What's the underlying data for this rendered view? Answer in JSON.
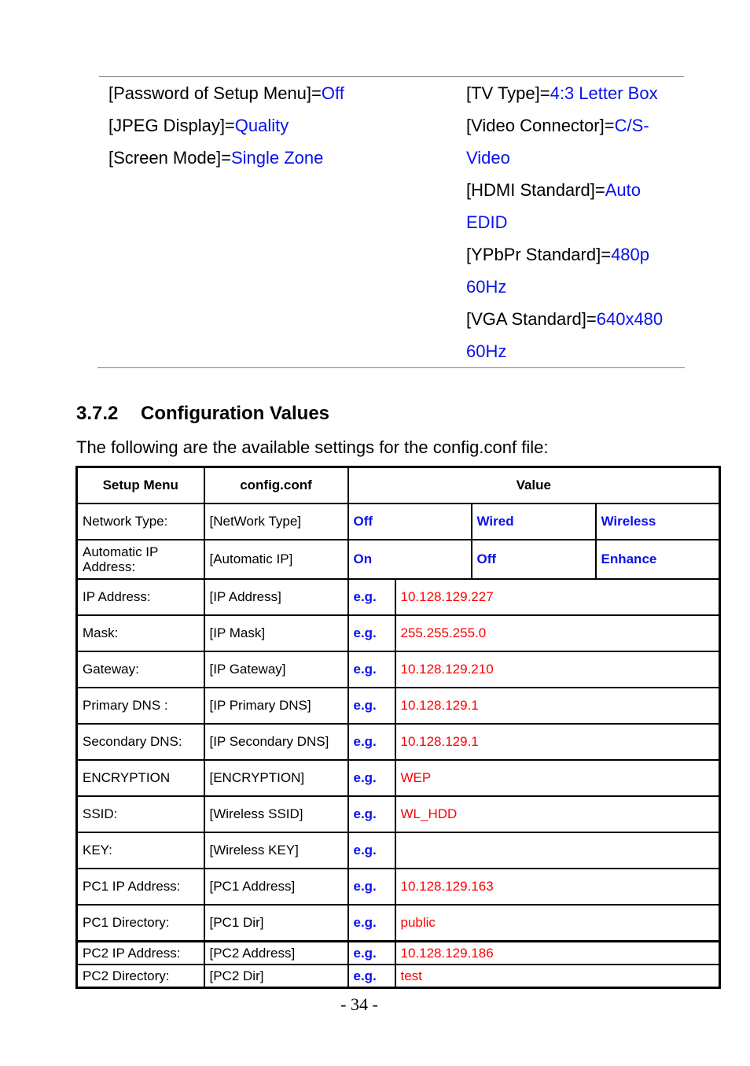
{
  "settings_left": [
    {
      "key": "[Password of Setup Menu]=",
      "value": "Off"
    },
    {
      "key": "[JPEG Display]=",
      "value": "Quality"
    },
    {
      "key": "[Screen Mode]=",
      "value": "Single Zone"
    }
  ],
  "settings_right": [
    {
      "key": "[TV Type]=",
      "value": "4:3 Letter Box"
    },
    {
      "key": "[Video Connector]=",
      "value": "C/S-Video"
    },
    {
      "key": "[HDMI Standard]=",
      "value": "Auto EDID"
    },
    {
      "key": "[YPbPr Standard]=",
      "value": "480p 60Hz"
    },
    {
      "key": "[VGA Standard]=",
      "value": "640x480 60Hz"
    }
  ],
  "section": {
    "number": "3.7.2",
    "title": "Configuration Values",
    "intro": "The following are the available settings for the config.conf file:"
  },
  "table": {
    "headers": [
      "Setup Menu",
      "config.conf",
      "Value"
    ],
    "option_rows": [
      {
        "menu": "Network Type:",
        "conf": "[NetWork Type]",
        "options": [
          "Off",
          "Wired",
          "Wireless"
        ]
      },
      {
        "menu": "Automatic IP Address:",
        "conf": "[Automatic IP]",
        "options": [
          "On",
          "Off",
          "Enhance"
        ]
      }
    ],
    "example_prefix": "e.g.",
    "example_rows": [
      {
        "menu": "IP Address:",
        "conf": "[IP Address]",
        "example": "10.128.129.227"
      },
      {
        "menu": "Mask:",
        "conf": "[IP Mask]",
        "example": "255.255.255.0"
      },
      {
        "menu": "Gateway:",
        "conf": "[IP Gateway]",
        "example": "10.128.129.210"
      },
      {
        "menu": "Primary DNS :",
        "conf": "[IP Primary DNS]",
        "example": "10.128.129.1"
      },
      {
        "menu": "Secondary DNS:",
        "conf": "[IP Secondary DNS]",
        "example": "10.128.129.1"
      },
      {
        "menu": "ENCRYPTION",
        "conf": "[ENCRYPTION]",
        "example": "WEP"
      },
      {
        "menu": "SSID:",
        "conf": "[Wireless SSID]",
        "example": "WL_HDD"
      },
      {
        "menu": "KEY:",
        "conf": "[Wireless KEY]",
        "example": ""
      },
      {
        "menu": "PC1 IP Address:",
        "conf": "[PC1 Address]",
        "example": "10.128.129.163"
      },
      {
        "menu": "PC1 Directory:",
        "conf": "[PC1 Dir]",
        "example": "public"
      },
      {
        "menu": "PC2 IP Address:",
        "conf": "[PC2 Address]",
        "example": "10.128.129.186"
      },
      {
        "menu": "PC2 Directory:",
        "conf": "[PC2 Dir]",
        "example": "test"
      }
    ]
  },
  "page_number": "- 34 -",
  "colors": {
    "value_blue": "#0a12ea",
    "example_red": "#ff0000",
    "rule_gray": "#808080"
  }
}
